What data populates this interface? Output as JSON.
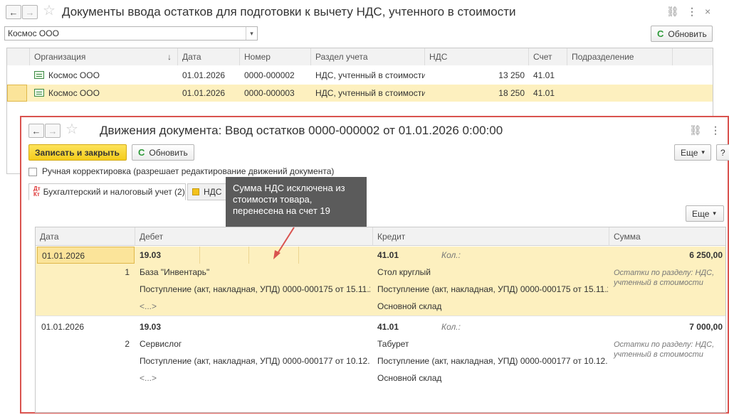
{
  "main_window": {
    "title": "Документы ввода остатков для подготовки к вычету НДС, учтенного в стоимости",
    "back_icon": "arrow-left-icon",
    "forward_icon": "arrow-right-icon",
    "org_select_value": "Космос ООО",
    "refresh_label": "Обновить",
    "columns": [
      "Организация",
      "Дата",
      "Номер",
      "Раздел учета",
      "НДС",
      "Счет",
      "Подразделение"
    ],
    "sort_indicator": "↓",
    "rows": [
      {
        "org": "Космос ООО",
        "date": "01.01.2026",
        "number": "0000-000002",
        "section": "НДС, учтенный в стоимости",
        "vat": "13 250",
        "account": "41.01",
        "unit": ""
      },
      {
        "org": "Космос ООО",
        "date": "01.01.2026",
        "number": "0000-000003",
        "section": "НДС, учтенный в стоимости",
        "vat": "18 250",
        "account": "41.01",
        "unit": ""
      }
    ]
  },
  "movements_window": {
    "title": "Движения документа: Ввод остатков 0000-000002 от 01.01.2026 0:00:00",
    "save_close_label": "Записать и закрыть",
    "refresh_label": "Обновить",
    "more_label": "Еще",
    "help_label": "?",
    "manual_correction_label": "Ручная корректировка (разрешает редактирование движений документа)",
    "tabs": [
      {
        "label": "Бухгалтерский и налоговый учет (2)",
        "icon_text": "Дт/Кт"
      },
      {
        "label": "НДС",
        "icon_text": ""
      }
    ],
    "tab_icon_dt": "Дт",
    "tab_icon_kt": "Кт",
    "tab_more_label": "Еще",
    "grid_columns": [
      "Дата",
      "Дебет",
      "Кредит",
      "Сумма"
    ],
    "entries": [
      {
        "date": "01.01.2026",
        "num": "1",
        "debit_account": "19.03",
        "debit_sub1": "База \"Инвентарь\"",
        "debit_sub2": "Поступление (акт, накладная, УПД) 0000-000175 от 15.11.2...",
        "debit_sub3": "<...>",
        "credit_account": "41.01",
        "credit_qty_label": "Кол.:",
        "credit_sub1": "Стол круглый",
        "credit_sub2": "Поступление (акт, накладная, УПД) 0000-000175 от 15.11.2...",
        "credit_sub3": "Основной склад",
        "amount": "6 250,00",
        "comment": "Остатки по разделу: НДС, учтенный в стоимости"
      },
      {
        "date": "01.01.2026",
        "num": "2",
        "debit_account": "19.03",
        "debit_sub1": "Сервислог",
        "debit_sub2": "Поступление (акт, накладная, УПД) 0000-000177 от 10.12.2...",
        "debit_sub3": "<...>",
        "credit_account": "41.01",
        "credit_qty_label": "Кол.:",
        "credit_sub1": "Табурет",
        "credit_sub2": "Поступление (акт, накладная, УПД) 0000-000177 от 10.12.2...",
        "credit_sub3": "Основной склад",
        "amount": "7 000,00",
        "comment": "Остатки по разделу: НДС, учтенный в стоимости"
      }
    ]
  },
  "annotation": {
    "text": "Сумма НДС исключена из стоимости товара, перенесена на счет 19",
    "color": "#d9534f"
  },
  "colors": {
    "selection": "#fdf0bf",
    "accent_yellow": "#f4cc1c",
    "frame_red": "#d9534f"
  }
}
